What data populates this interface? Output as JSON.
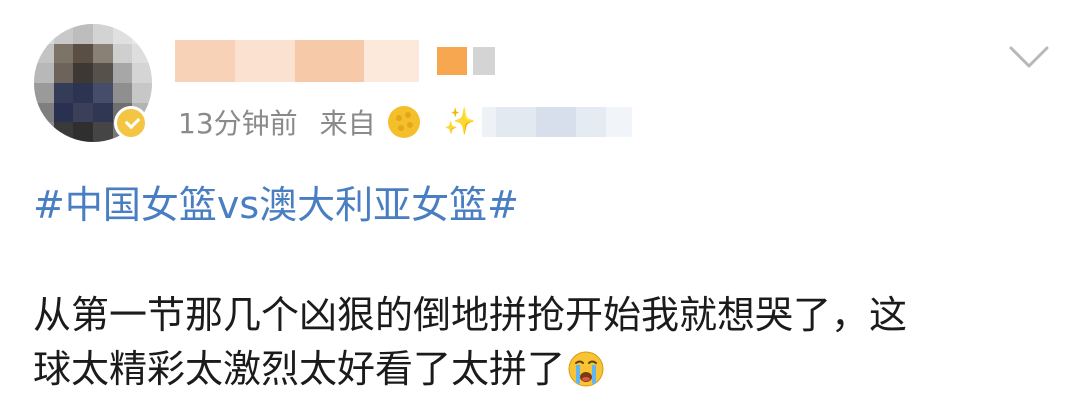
{
  "post": {
    "meta": {
      "time": "13分钟前",
      "from_label": "来自"
    },
    "topic": "#中国女篮vs澳大利亚女篮#",
    "content_lines": [
      "从第一节那几个凶狠的倒地拼抢开始我就想哭了，这",
      "球太精彩太激烈太好看了太拼了"
    ],
    "emoji": "crying-face-icon"
  },
  "icons": {
    "expand": "chevron-down-icon",
    "source": "moon-icon",
    "sparkle": "sparkle-icon",
    "verified": "verified-badge-icon"
  },
  "colors": {
    "topic": "#4a7ec2",
    "meta": "#8a8a8a",
    "text": "#1b1b1b",
    "badge": "#f4c542"
  }
}
